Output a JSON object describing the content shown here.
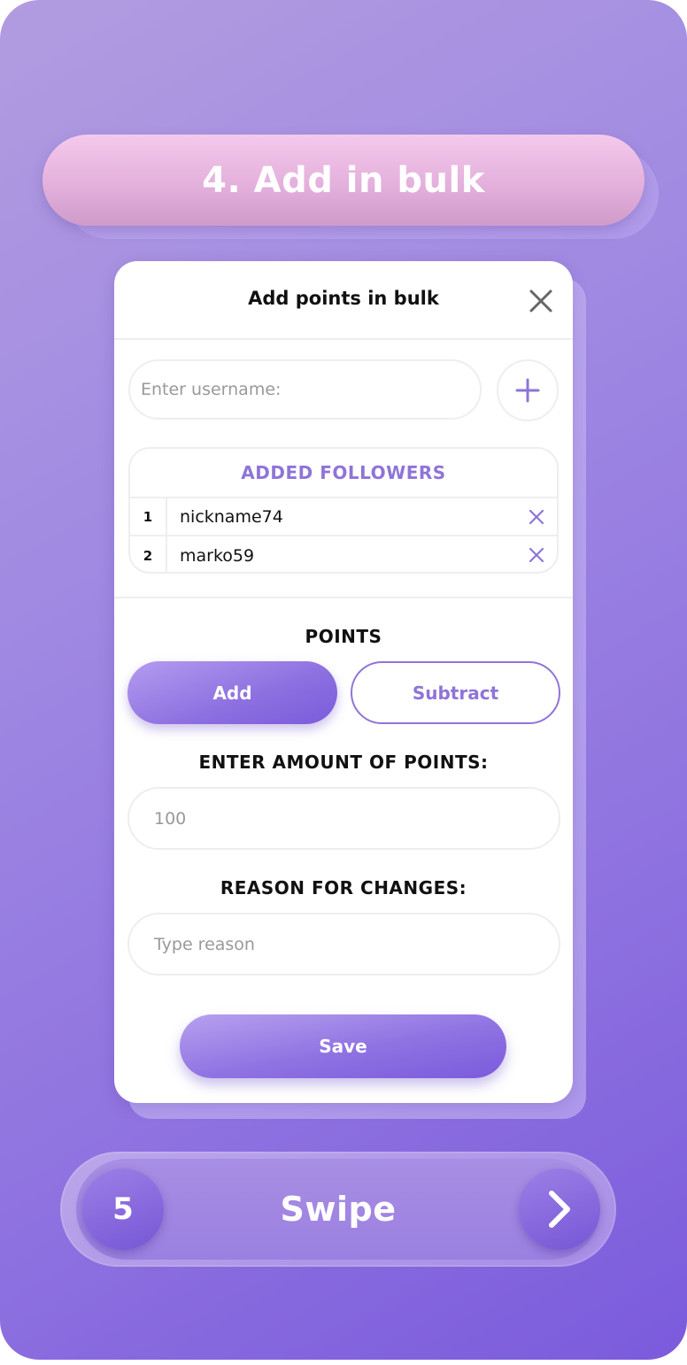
{
  "step": {
    "title": "4. Add in bulk"
  },
  "modal": {
    "title": "Add points in bulk",
    "close_icon": "close-icon",
    "username_placeholder": "Enter username:",
    "add_icon": "plus-icon",
    "followers_header": "ADDED FOLLOWERS",
    "followers": [
      {
        "index": "1",
        "name": "nickname74"
      },
      {
        "index": "2",
        "name": "marko59"
      }
    ],
    "points_label": "POINTS",
    "mode_add": "Add",
    "mode_subtract": "Subtract",
    "selected_mode": "Add",
    "amount_label": "ENTER AMOUNT OF POINTS:",
    "amount_placeholder": "100",
    "reason_label": "REASON FOR CHANGES:",
    "reason_placeholder": "Type reason",
    "save_label": "Save"
  },
  "swipe": {
    "next_step": "5",
    "label": "Swipe",
    "arrow_icon": "chevron-right-icon"
  },
  "colors": {
    "accent": "#8f74d8",
    "step_pill": "#e4b0dc",
    "background": "#8f72e0"
  }
}
